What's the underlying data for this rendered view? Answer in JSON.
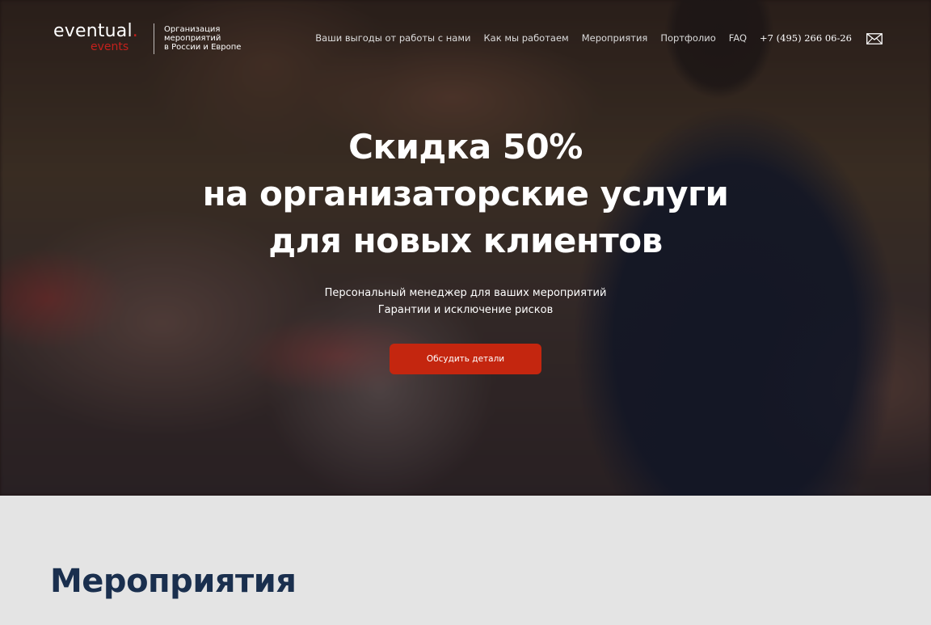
{
  "brand": {
    "name": "eventual",
    "dot": ".",
    "sub": "events",
    "tagline": [
      "Организация",
      "мероприятий",
      "в России и Европе"
    ]
  },
  "nav": {
    "items": [
      {
        "label": "Ваши выгоды от работы с нами"
      },
      {
        "label": "Как мы работаем"
      },
      {
        "label": "Мероприятия"
      },
      {
        "label": "Портфолио"
      },
      {
        "label": "FAQ"
      }
    ],
    "phone": "+7 (495) 266 06-26",
    "mail_icon": "mail-icon"
  },
  "hero": {
    "headline": [
      "Скидка 50%",
      "на организаторские услуги",
      "для новых клиентов"
    ],
    "subtitle": [
      "Персональный менеджер для ваших мероприятий",
      "Гарантии и исключение рисков"
    ],
    "cta_label": "Обсудить детали"
  },
  "events": {
    "title": "Мероприятия"
  },
  "colors": {
    "accent": "#c4260f",
    "brand_red": "#c4211c",
    "section_bg": "#e4e4e4",
    "title_color": "#1a2f4e"
  }
}
